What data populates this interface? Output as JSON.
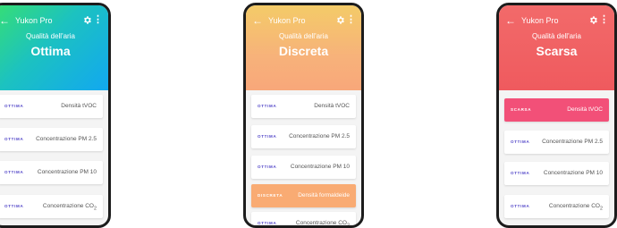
{
  "app": {
    "title": "Yukon Pro",
    "back_icon": "arrow-left-icon",
    "settings_icon": "gear-icon",
    "menu_icon": "more-vert-icon"
  },
  "phones": [
    {
      "subtitle": "Qualità dell'aria",
      "quality": "Ottima",
      "cards": [
        {
          "status": "OTTIMA",
          "label": "Densità tVOC"
        },
        {
          "status": "OTTIMA",
          "label": "Concentrazione PM 2.5"
        },
        {
          "status": "OTTIMA",
          "label": "Concentrazione PM 10"
        },
        {
          "status": "OTTIMA",
          "label": "Concentrazione CO",
          "sub": "2"
        }
      ]
    },
    {
      "subtitle": "Qualità dell'aria",
      "quality": "Discreta",
      "cards": [
        {
          "status": "OTTIMA",
          "label": "Densità tVOC"
        },
        {
          "status": "OTTIMA",
          "label": "Concentrazione PM 2.5"
        },
        {
          "status": "OTTIMA",
          "label": "Concentrazione PM 10"
        },
        {
          "status": "DISCRETA",
          "label": "Densità formaldeide"
        },
        {
          "status": "OTTIMA",
          "label": "Concentrazione CO",
          "sub": "2"
        }
      ]
    },
    {
      "subtitle": "Qualità dell'aria",
      "quality": "Scarsa",
      "cards": [
        {
          "status": "SCARSA",
          "label": "Densità tVOC"
        },
        {
          "status": "OTTIMA",
          "label": "Concentrazione PM 2.5"
        },
        {
          "status": "OTTIMA",
          "label": "Concentrazione PM 10"
        },
        {
          "status": "OTTIMA",
          "label": "Concentrazione CO",
          "sub": "2"
        }
      ]
    }
  ],
  "colors": {
    "status_good": "#5145c8",
    "moderate": "#f9ab73",
    "poor": "#f25078"
  }
}
